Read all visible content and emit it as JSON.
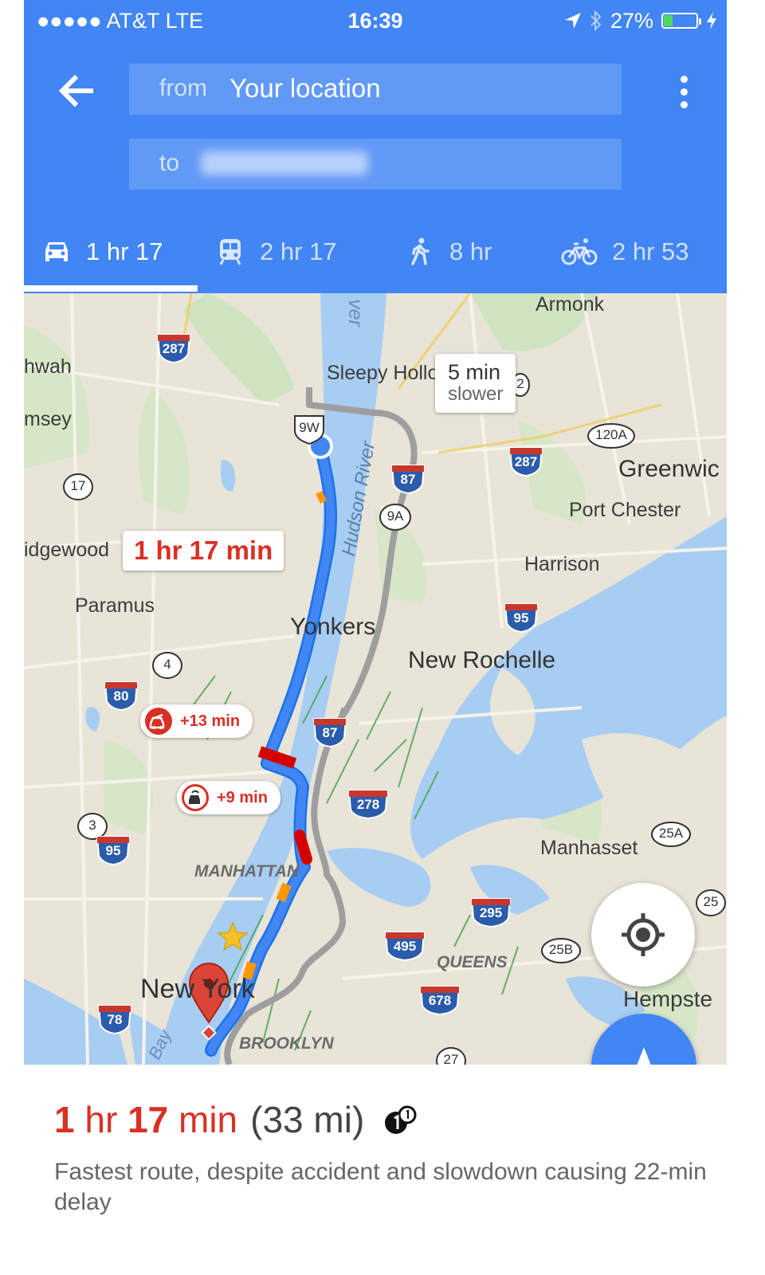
{
  "status_bar": {
    "carrier": "●●●●● AT&T  LTE",
    "time": "16:39",
    "battery": "27%",
    "battery_level": 0.27
  },
  "header": {
    "from_prefix": "from",
    "from_value": "Your location",
    "to_prefix": "to"
  },
  "modes": [
    {
      "mode": "drive",
      "icon": "car-icon",
      "label": "1 hr 17",
      "active": true
    },
    {
      "mode": "transit",
      "icon": "train-icon",
      "label": "2 hr 17",
      "active": false
    },
    {
      "mode": "walk",
      "icon": "walking-icon",
      "label": "8 hr",
      "active": false
    },
    {
      "mode": "bike",
      "icon": "bicycle-icon",
      "label": "2 hr 53",
      "active": false
    }
  ],
  "map": {
    "places": [
      "Armonk",
      "hwah",
      "Sleepy Hollo",
      "msey",
      "Greenwic",
      "Port Chester",
      "idgewood",
      "Harrison",
      "Paramus",
      "Yonkers",
      "New Rochelle",
      "Manhasset",
      "MANHATTAN",
      "QUEENS",
      "New York",
      "Hempste",
      "BROOKLYN",
      "ver",
      "Hudson River",
      "Bay"
    ],
    "shields": [
      "287",
      "287",
      "87",
      "9A",
      "120A",
      "17",
      "95",
      "4",
      "80",
      "87",
      "278",
      "3",
      "95",
      "25A",
      "295",
      "495",
      "25B",
      "25",
      "678",
      "78",
      "27",
      "9W",
      "2"
    ],
    "route_label": "1 hr 17 min",
    "alt_route_time": "5 min",
    "alt_route_note": "slower",
    "delay_accident": "+13 min",
    "delay_slowdown": "+9 min",
    "route_color": "#4285f4",
    "alt_route_color": "#9e9e9e",
    "traffic_red": "#d50000",
    "traffic_orange": "#ff9800"
  },
  "summary": {
    "num1": "1",
    "unit1": "hr",
    "num2": "17",
    "unit2": "min",
    "distance": "(33 mi)",
    "description": "Fastest route, despite accident and slowdown causing 22-min delay"
  }
}
